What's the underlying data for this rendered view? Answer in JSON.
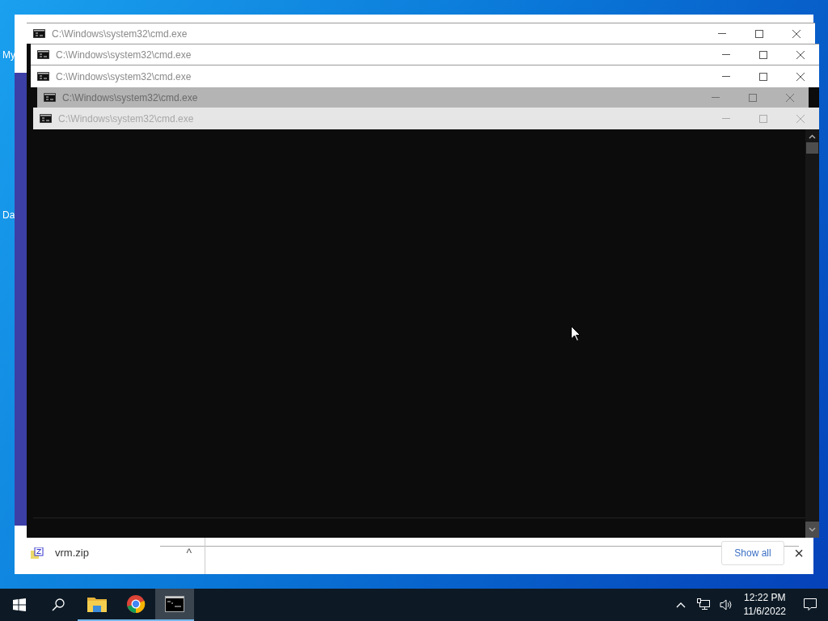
{
  "desktop_icons": [
    {
      "label": "My"
    },
    {
      "label": "Da"
    }
  ],
  "browser": {
    "download": {
      "file": "vrm.zip",
      "caret": "^"
    },
    "show_all": "Show all",
    "close": "×"
  },
  "windows": [
    {
      "title": "C:\\Windows\\system32\\cmd.exe",
      "kind": "normal"
    },
    {
      "title": "C:\\Windows\\system32\\cmd.exe",
      "kind": "normal"
    },
    {
      "title": "C:\\Windows\\system32\\cmd.exe",
      "kind": "normal"
    },
    {
      "title": "C:\\Windows\\system32\\cmd.exe",
      "kind": "shaded"
    },
    {
      "title": "C:\\Windows\\system32\\cmd.exe",
      "kind": "faded"
    }
  ],
  "taskbar": {
    "apps": [
      {
        "kind": "explorer",
        "selected": false
      },
      {
        "kind": "chrome",
        "selected": false
      },
      {
        "kind": "cmd",
        "selected": true
      }
    ],
    "time": "12:22 PM",
    "date": "11/6/2022"
  }
}
